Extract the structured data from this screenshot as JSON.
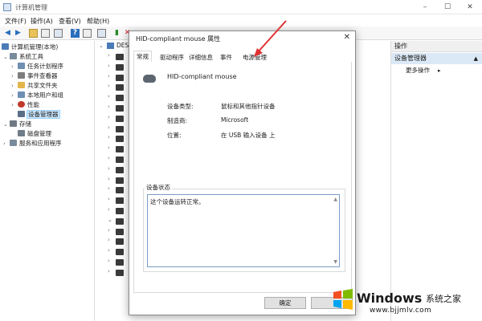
{
  "window": {
    "title": "计算机管理"
  },
  "menu": [
    "文件(F)",
    "操作(A)",
    "查看(V)",
    "帮助(H)"
  ],
  "tree": [
    {
      "label": "计算机管理(本地)",
      "icon": "computer-icon",
      "color": "#4a7bb7"
    },
    {
      "label": "系统工具",
      "icon": "tools-icon",
      "color": "#7a8c9c"
    },
    {
      "label": "任务计划程序",
      "icon": "clock-icon",
      "color": "#6f8fb3"
    },
    {
      "label": "事件查看器",
      "icon": "event-viewer-icon",
      "color": "#7d7d7d"
    },
    {
      "label": "共享文件夹",
      "icon": "shared-folder-icon",
      "color": "#e3b64c"
    },
    {
      "label": "本地用户和组",
      "icon": "users-icon",
      "color": "#6d8fb5"
    },
    {
      "label": "性能",
      "icon": "performance-icon",
      "color": "#c0392b"
    },
    {
      "label": "设备管理器",
      "icon": "device-manager-icon",
      "color": "#5a6e86"
    },
    {
      "label": "存储",
      "icon": "storage-icon",
      "color": "#707a84"
    },
    {
      "label": "磁盘管理",
      "icon": "disk-icon",
      "color": "#6f7c8a"
    },
    {
      "label": "服务和应用程序",
      "icon": "services-icon",
      "color": "#7a8c9c"
    }
  ],
  "device_list": {
    "root_label": "DES"
  },
  "actions": {
    "header": "操作",
    "section": "设备管理器",
    "more": "更多操作"
  },
  "dialog": {
    "title": "HID-compliant mouse 属性",
    "tabs": [
      "常规",
      "驱动程序",
      "详细信息",
      "事件",
      "电源管理"
    ],
    "active_tab": "常规",
    "device_name": "HID-compliant mouse",
    "properties": [
      {
        "label": "设备类型:",
        "value": "鼠标和其他指针设备"
      },
      {
        "label": "制造商:",
        "value": "Microsoft"
      },
      {
        "label": "位置:",
        "value": "在 USB 输入设备 上"
      }
    ],
    "status_group_label": "设备状态",
    "status_text": "这个设备运转正常。",
    "ok_label": "确定"
  },
  "watermark": {
    "brand": "Windows",
    "brand_cn": "系统之家",
    "url": "www.bjjmlv.com"
  },
  "colors": {
    "accent": "#0078d7",
    "selection": "#cce8ff",
    "arrow": "#e03131"
  }
}
